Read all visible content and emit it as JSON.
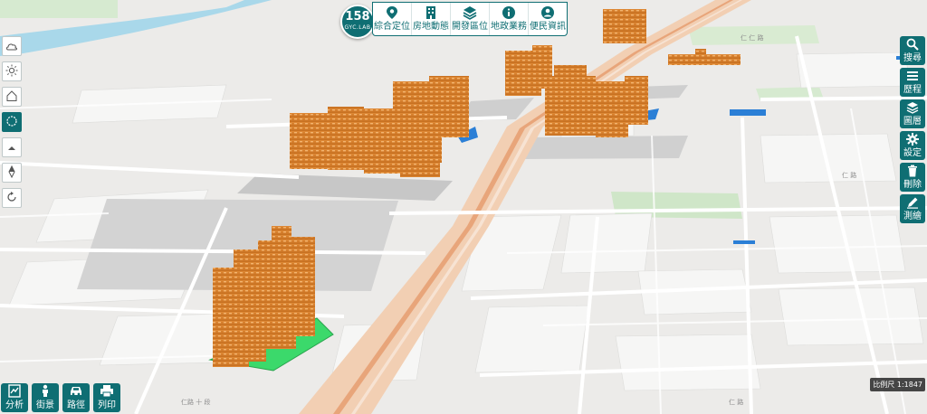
{
  "logo": {
    "number": "158",
    "subtitle": "GYC.LAB"
  },
  "topnav": [
    {
      "label": "綜合定位",
      "icon": "location-pin-icon"
    },
    {
      "label": "房地動態",
      "icon": "building-icon"
    },
    {
      "label": "開發區位",
      "icon": "layers-stack-icon"
    },
    {
      "label": "地政業務",
      "icon": "info-icon"
    },
    {
      "label": "便民資訊",
      "icon": "person-icon"
    }
  ],
  "rightbar": [
    {
      "label": "搜尋",
      "icon": "magnifier-icon"
    },
    {
      "label": "歷程",
      "icon": "list-icon"
    },
    {
      "label": "圖層",
      "icon": "layers-icon"
    },
    {
      "label": "設定",
      "icon": "gear-icon"
    },
    {
      "label": "刪除",
      "icon": "trash-icon"
    },
    {
      "label": "測繪",
      "icon": "pencil-icon"
    }
  ],
  "leftbar": [
    {
      "icon": "weather-cloud-icon"
    },
    {
      "icon": "sun-icon"
    },
    {
      "icon": "home-icon"
    },
    {
      "icon": "compass-icon"
    },
    {
      "icon": "tilt-up-icon"
    },
    {
      "icon": "north-arrow-icon"
    },
    {
      "icon": "rotate-icon"
    }
  ],
  "bottombar": [
    {
      "label": "分析",
      "icon": "analysis-icon"
    },
    {
      "label": "街景",
      "icon": "person-streetview-icon"
    },
    {
      "label": "路徑",
      "icon": "car-icon"
    },
    {
      "label": "列印",
      "icon": "printer-icon"
    }
  ],
  "scale_text": "比例尺 1:1847",
  "colors": {
    "accent": "#0f6e73",
    "building": "#d9802e",
    "highlight": "#3bd96b",
    "map_bg": "#ecebe9"
  }
}
